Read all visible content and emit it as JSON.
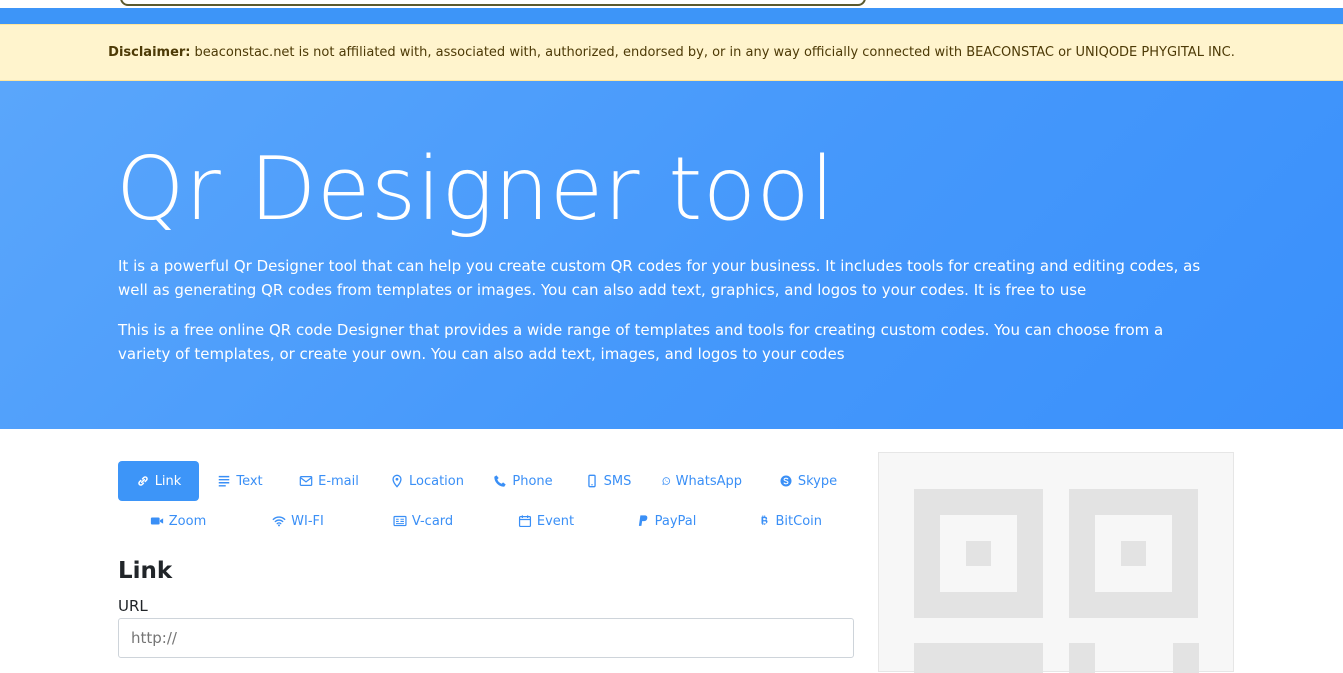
{
  "disclaimer": {
    "label": "Disclaimer:",
    "text": "beaconstac.net is not affiliated with, associated with, authorized, endorsed by, or in any way officially connected with BEACONSTAC or UNIQODE PHYGITAL INC."
  },
  "hero": {
    "title": "Qr Designer tool",
    "paragraph1": "It is a powerful Qr Designer tool that can help you create custom QR codes for your business. It includes tools for creating and editing codes, as well as generating QR codes from templates or images. You can also add text, graphics, and logos to your codes. It is free to use",
    "paragraph2": "This is a free online QR code Designer that provides a wide range of templates and tools for creating custom codes. You can choose from a variety of templates, or create your own. You can also add text, images, and logos to your codes"
  },
  "tabs": [
    {
      "label": "Link",
      "icon": "link-icon",
      "active": true
    },
    {
      "label": "Text",
      "icon": "text-icon"
    },
    {
      "label": "E-mail",
      "icon": "envelope-icon"
    },
    {
      "label": "Location",
      "icon": "map-pin-icon"
    },
    {
      "label": "Phone",
      "icon": "phone-icon"
    },
    {
      "label": "SMS",
      "icon": "mobile-icon"
    },
    {
      "label": "WhatsApp",
      "icon": "whatsapp-icon"
    },
    {
      "label": "Skype",
      "icon": "skype-icon"
    },
    {
      "label": "Zoom",
      "icon": "video-icon"
    },
    {
      "label": "WI-FI",
      "icon": "wifi-icon"
    },
    {
      "label": "V-card",
      "icon": "vcard-icon"
    },
    {
      "label": "Event",
      "icon": "calendar-icon"
    },
    {
      "label": "PayPal",
      "icon": "paypal-icon"
    },
    {
      "label": "BitCoin",
      "icon": "bitcoin-icon"
    }
  ],
  "form": {
    "title": "Link",
    "url_label": "URL",
    "url_placeholder": "http://"
  },
  "colors": {
    "accent": "#3d95f8",
    "disclaimer_bg": "#fff4cd",
    "qr_placeholder": "#e3e3e3"
  }
}
